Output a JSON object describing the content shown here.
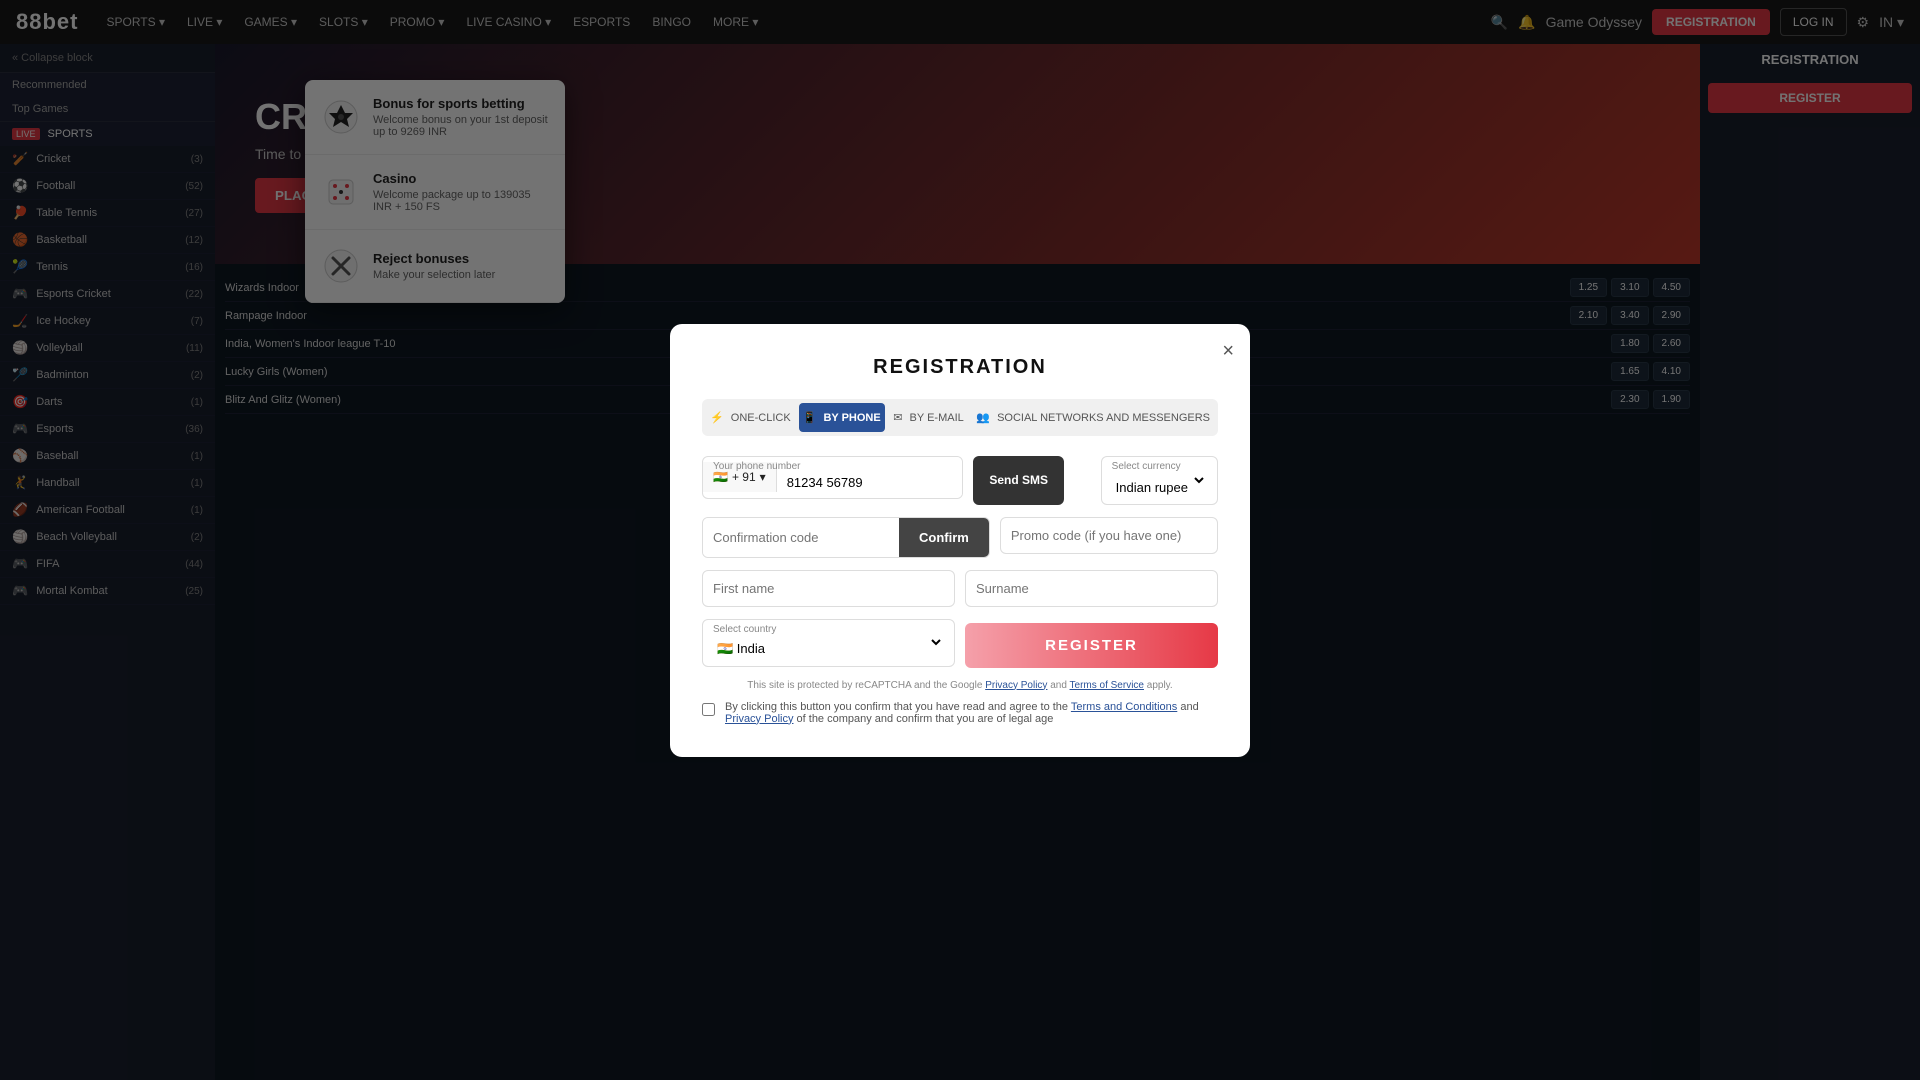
{
  "site": {
    "logo": "88bet",
    "logo_prefix": "88"
  },
  "nav": {
    "items": [
      {
        "label": "SPORTS",
        "has_arrow": true
      },
      {
        "label": "LIVE",
        "has_arrow": true
      },
      {
        "label": "GAMES",
        "has_arrow": true
      },
      {
        "label": "SLOTS",
        "has_arrow": true
      },
      {
        "label": "PROMO",
        "has_arrow": true
      },
      {
        "label": "LIVE CASINO",
        "has_arrow": true
      },
      {
        "label": "ESPORTS"
      },
      {
        "label": "BINGO"
      },
      {
        "label": "MORE",
        "has_arrow": true
      }
    ],
    "user_display": "Game Odyssey",
    "btn_registration": "REGISTRATION",
    "btn_login": "LOG IN"
  },
  "sidebar": {
    "collapse_label": "« Collapse block",
    "recommended_label": "Recommended",
    "top_games_label": "Top Games",
    "live_label": "• LIVE",
    "sports_label": "SPORTS",
    "sports": [
      {
        "name": "Cricket",
        "count": "3",
        "emoji": "🏏"
      },
      {
        "name": "Football",
        "count": "52",
        "emoji": "⚽"
      },
      {
        "name": "Table Tennis",
        "count": "27",
        "emoji": "🏓"
      },
      {
        "name": "Basketball",
        "count": "12",
        "emoji": "🏀"
      },
      {
        "name": "Tennis",
        "count": "16",
        "emoji": "🎾"
      },
      {
        "name": "Esports Cricket",
        "count": "22",
        "emoji": "🎮"
      },
      {
        "name": "Ice Hockey",
        "count": "7",
        "emoji": "🏒"
      },
      {
        "name": "Volleyball",
        "count": "11",
        "emoji": "🏐"
      },
      {
        "name": "Badminton",
        "count": "2",
        "emoji": "🏸"
      },
      {
        "name": "Darts",
        "count": "1",
        "emoji": "🎯"
      },
      {
        "name": "Esports",
        "count": "36",
        "emoji": "🎮"
      },
      {
        "name": "Baseball",
        "count": "1",
        "emoji": "⚾"
      },
      {
        "name": "Handball",
        "count": "1",
        "emoji": "🤾"
      },
      {
        "name": "American Football",
        "count": "1",
        "emoji": "🏈"
      },
      {
        "name": "Beach Volleyball",
        "count": "2",
        "emoji": "🏐"
      },
      {
        "name": "FIFA",
        "count": "44",
        "emoji": "🎮"
      },
      {
        "name": "Mortal Kombat",
        "count": "25",
        "emoji": "🎮"
      }
    ]
  },
  "hero": {
    "title": "CRICKET TOUR",
    "subtitle": "Time to hit the road!",
    "btn_label": "PLACE A BET"
  },
  "bonus_popup": {
    "items": [
      {
        "id": "sports",
        "title": "Bonus for sports betting",
        "description": "Welcome bonus on your 1st deposit up to 9269 INR",
        "icon": "soccer"
      },
      {
        "id": "casino",
        "title": "Casino",
        "description": "Welcome package up to 139035 INR + 150 FS",
        "icon": "casino"
      },
      {
        "id": "reject",
        "title": "Reject bonuses",
        "description": "Make your selection later",
        "icon": "reject"
      }
    ]
  },
  "modal": {
    "title": "REGISTRATION",
    "close_label": "×",
    "tabs": [
      {
        "id": "one-click",
        "label": "ONE-CLICK",
        "icon": "⚡",
        "active": false
      },
      {
        "id": "by-phone",
        "label": "BY PHONE",
        "icon": "📱",
        "active": true
      },
      {
        "id": "by-email",
        "label": "BY E-MAIL",
        "icon": "✉",
        "active": false
      },
      {
        "id": "social",
        "label": "SOCIAL NETWORKS AND MESSENGERS",
        "icon": "👥",
        "active": false
      }
    ],
    "phone_label": "Your phone number",
    "phone_flag": "🇮🇳",
    "phone_code": "+ 91",
    "phone_placeholder": "81234 56789",
    "send_sms_label": "Send SMS",
    "currency_label": "Select currency",
    "currency_value": "Indian rupee (INR)",
    "confirm_code_placeholder": "Confirmation code",
    "confirm_btn_label": "Confirm",
    "promo_placeholder": "Promo code (if you have one)",
    "first_name_placeholder": "First name",
    "surname_placeholder": "Surname",
    "country_label": "Select country",
    "country_value": "India",
    "register_btn_label": "REGISTER",
    "recaptcha_text": "This site is protected by reCAPTCHA and the Google",
    "privacy_policy_label": "Privacy Policy",
    "and_label": "and",
    "terms_label": "Terms of Service",
    "apply_label": "apply.",
    "checkbox_text": "By clicking this button you confirm that you have read and agree to the",
    "terms_conditions_label": "Terms and Conditions",
    "checkbox_text2": "and",
    "privacy_label2": "Privacy Policy",
    "checkbox_text3": "of the company and confirm that you are of legal age"
  },
  "right_sidebar": {
    "title": "REGISTRATION",
    "register_btn": "REGISTER"
  }
}
